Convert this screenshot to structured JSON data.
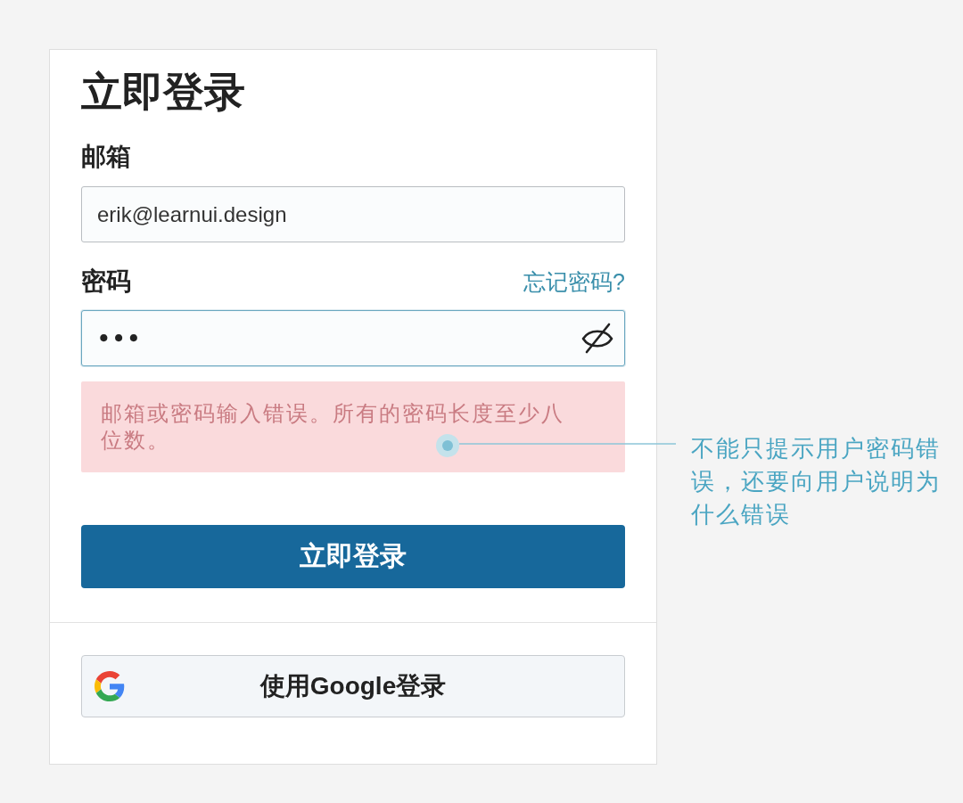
{
  "login_card": {
    "title": "立即登录",
    "email": {
      "label": "邮箱",
      "value": "erik@learnui.design"
    },
    "password": {
      "label": "密码",
      "forgot_link": "忘记密码?",
      "value": "•••",
      "focused": true,
      "revealed": false
    },
    "error": {
      "message": "邮箱或密码输入错误。所有的密码长度至少八位数。"
    },
    "submit_button": "立即登录",
    "google_button": "使用Google登录"
  },
  "annotation": {
    "text": "不能只提示用户密码错误，还要向用户说明为什么错误"
  }
}
